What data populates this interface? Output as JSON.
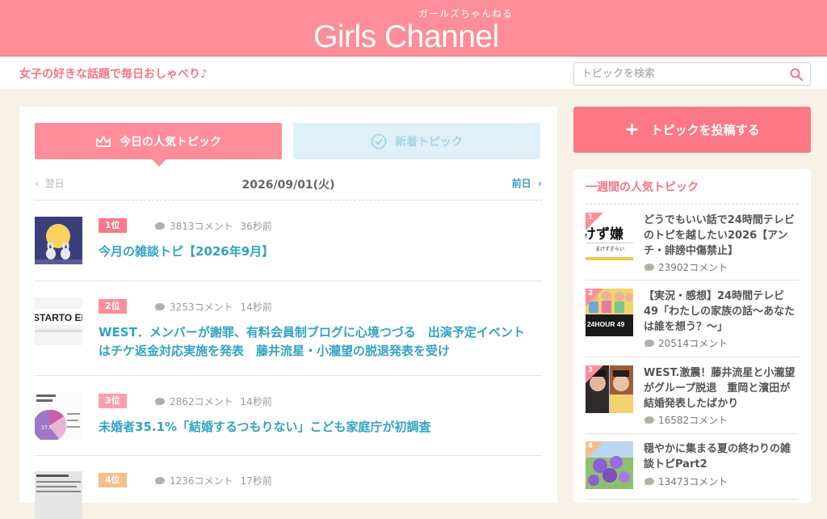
{
  "header": {
    "logo_text": "Girls Channel",
    "logo_kana": "ガールズちゃんねる"
  },
  "subheader": {
    "tagline": "女子の好きな話題で毎日おしゃべり♪"
  },
  "search": {
    "placeholder": "トピックを検索"
  },
  "tabs": {
    "popular": "今日の人気トピック",
    "new": "新着トピック"
  },
  "datebar": {
    "prev": "翌日",
    "date": "2026/09/01(火)",
    "next": "前日"
  },
  "topics": [
    {
      "rank": "1位",
      "comments": "3813コメント",
      "time": "36秒前",
      "title": "今月の雑談トピ【2026年9月】"
    },
    {
      "rank": "2位",
      "comments": "3253コメント",
      "time": "14秒前",
      "title": "WEST．メンバーが謝罪、有料会員制ブログに心境つづる　出演予定イベントはチケ返金対応実施を発表　藤井流星・小瀧望の脱退発表を受け",
      "thumb_text": "STARTO ENTE"
    },
    {
      "rank": "3位",
      "comments": "2862コメント",
      "time": "14秒前",
      "title": "未婚者35.1%「結婚するつもりない」こども家庭庁が初調査",
      "thumb_text": "37.5"
    },
    {
      "rank": "4位",
      "comments": "1236コメント",
      "time": "17秒前",
      "title": ""
    }
  ],
  "sidebar": {
    "post_button": "トピックを投稿する",
    "weekly_heading": "一週間の人気トピック",
    "items": [
      {
        "rank": "1",
        "title": "どうでもいい話で24時間テレビのトピを越したい2026【アンチ・誹謗中傷禁止】",
        "comments": "23902コメント",
        "thumb_text": "けず嫌",
        "thumb_sub": "まけずぎらい"
      },
      {
        "rank": "2",
        "title": "【実況・感想】24時間テレビ49「わたしの家族の話～あなたは誰を想う？～」",
        "comments": "20514コメント",
        "thumb_text": "24HOUR 49"
      },
      {
        "rank": "3",
        "title": "WEST.激震！藤井流星と小瀧望がグループ脱退　重岡と濱田が結婚発表したばかり",
        "comments": "16582コメント"
      },
      {
        "rank": "4",
        "title": "穏やかに集まる夏の終わりの雑談トピPart2",
        "comments": "13473コメント"
      }
    ]
  },
  "colors": {
    "header_pink": "#fd8d98",
    "accent_pink": "#f47586",
    "link_blue": "#33a2c4",
    "rank1": "#fd7886",
    "rank2": "#fd8d98",
    "rank3": "#fd9ea7",
    "rank4": "#f6be8a"
  }
}
